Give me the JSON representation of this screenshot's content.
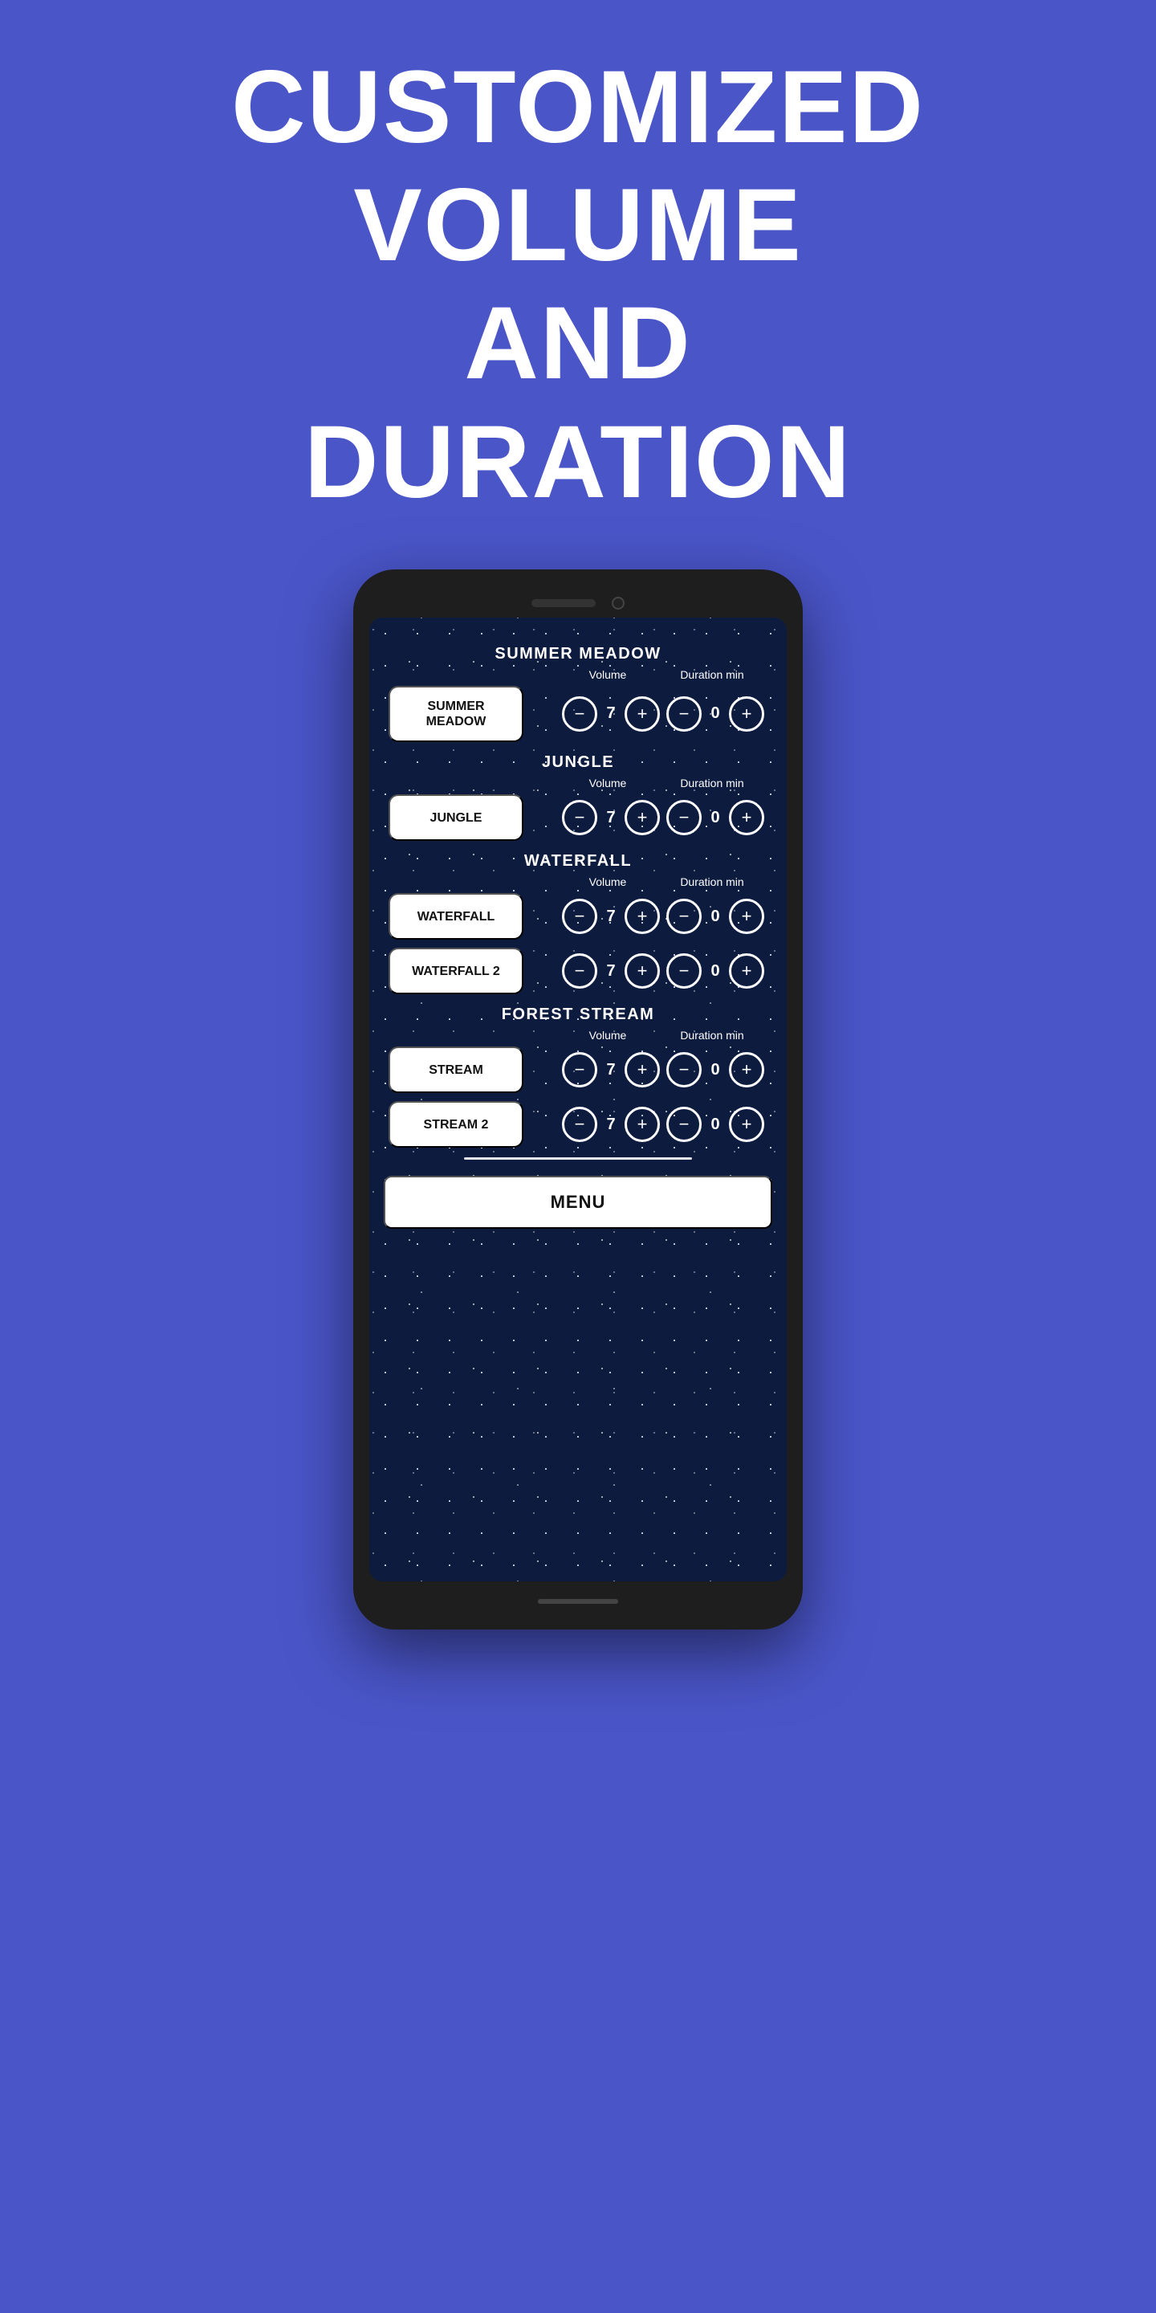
{
  "background_color": "#4a55c8",
  "hero": {
    "line1": "CUSTOMIZED",
    "line2": "VOLUME",
    "line3": "AND",
    "line4": "DURATION"
  },
  "phone": {
    "screen": {
      "sections": [
        {
          "heading": "SUMMER MEADOW",
          "col_volume": "Volume",
          "col_duration": "Duration min",
          "rows": [
            {
              "label": "SUMMER MEADOW",
              "volume": "7",
              "duration": "0"
            }
          ]
        },
        {
          "heading": "JUNGLE",
          "col_volume": "Volume",
          "col_duration": "Duration min",
          "rows": [
            {
              "label": "JUNGLE",
              "volume": "7",
              "duration": "0"
            }
          ]
        },
        {
          "heading": "WATERFALL",
          "col_volume": "Volume",
          "col_duration": "Duration min",
          "rows": [
            {
              "label": "WATERFALL",
              "volume": "7",
              "duration": "0"
            },
            {
              "label": "WATERFALL 2",
              "volume": "7",
              "duration": "0"
            }
          ]
        },
        {
          "heading": "FOREST STREAM",
          "col_volume": "Volume",
          "col_duration": "Duration min",
          "rows": [
            {
              "label": "STREAM",
              "volume": "7",
              "duration": "0"
            },
            {
              "label": "STREAM 2",
              "volume": "7",
              "duration": "0"
            }
          ]
        }
      ],
      "menu_label": "MENU"
    }
  },
  "buttons": {
    "minus": "−",
    "plus": "+"
  }
}
